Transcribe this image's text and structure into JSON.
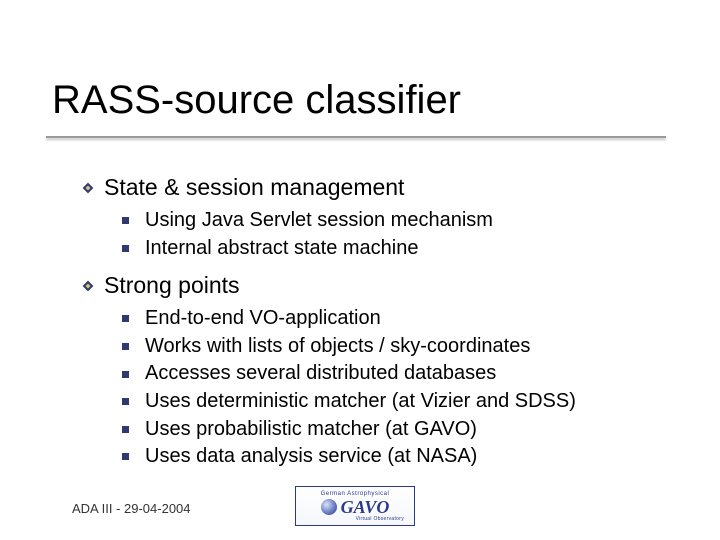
{
  "title": "RASS-source classifier",
  "sections": [
    {
      "header": "State & session management",
      "items": [
        "Using Java Servlet session mechanism",
        "Internal abstract state machine"
      ]
    },
    {
      "header": "Strong points",
      "items": [
        "End-to-end VO-application",
        "Works with lists of objects / sky-coordinates",
        "Accesses several distributed databases",
        "Uses deterministic matcher (at Vizier and SDSS)",
        "Uses probabilistic matcher (at GAVO)",
        "Uses data analysis service (at NASA)"
      ]
    }
  ],
  "footer": "ADA III - 29-04-2004",
  "logo": {
    "top": "German Astrophysical",
    "main": "GAVO",
    "sub": "Virtual Observatory"
  }
}
